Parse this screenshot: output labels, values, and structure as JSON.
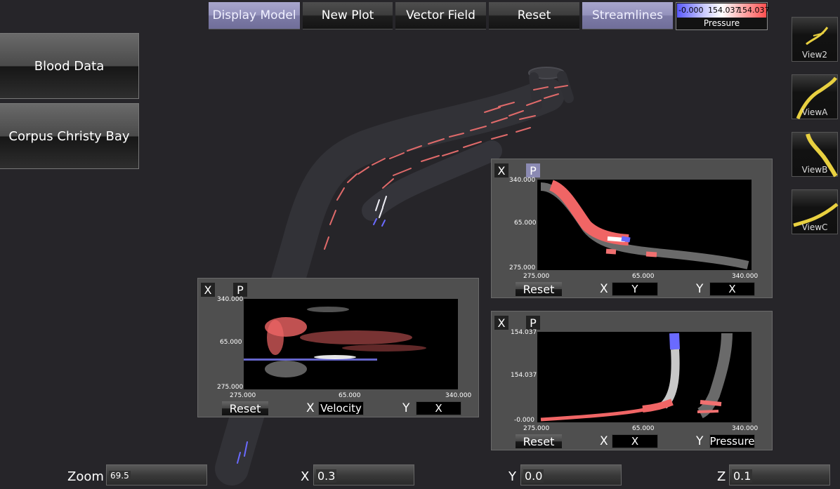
{
  "toolbar": {
    "display_model": "Display Model",
    "new_plot": "New Plot",
    "vector_field": "Vector Field",
    "reset": "Reset",
    "streamlines": "Streamlines"
  },
  "legend": {
    "min": "-0.000",
    "mid": "154.037",
    "max": "154.037",
    "label": "Pressure",
    "colors": {
      "low": "#5a5aff",
      "mid": "#ffffff",
      "high": "#ff5050"
    }
  },
  "datasets": {
    "blood": "Blood Data",
    "bay": "Corpus Christy Bay"
  },
  "views": [
    "View2",
    "ViewA",
    "ViewB",
    "ViewC"
  ],
  "plot1": {
    "close": "X",
    "pin": "P",
    "y_ticks": [
      "340.000",
      "65.000",
      "275.000"
    ],
    "x_ticks": [
      "275.000",
      "65.000",
      "340.000"
    ],
    "reset": "Reset",
    "x_label": "X",
    "x_value": "Velocity",
    "y_label": "Y",
    "y_value": "X"
  },
  "plot2": {
    "close": "X",
    "pin": "P",
    "y_ticks": [
      "340.000",
      "65.000",
      "275.000"
    ],
    "x_ticks": [
      "275.000",
      "65.000",
      "340.000"
    ],
    "reset": "Reset",
    "x_label": "X",
    "x_value": "Y",
    "y_label": "Y",
    "y_value": "X"
  },
  "plot3": {
    "close": "X",
    "pin": "P",
    "y_ticks": [
      "154.037",
      "154.037",
      "-0.000"
    ],
    "x_ticks": [
      "275.000",
      "65.000",
      "340.000"
    ],
    "reset": "Reset",
    "x_label": "X",
    "x_value": "X",
    "y_label": "Y",
    "y_value": "Pressure"
  },
  "sliders": {
    "zoom_label": "Zoom",
    "zoom_value": "69.5",
    "x_label": "X",
    "x_value": "0.3",
    "y_label": "Y",
    "y_value": "0.0",
    "z_label": "Z",
    "z_value": "0.1"
  }
}
